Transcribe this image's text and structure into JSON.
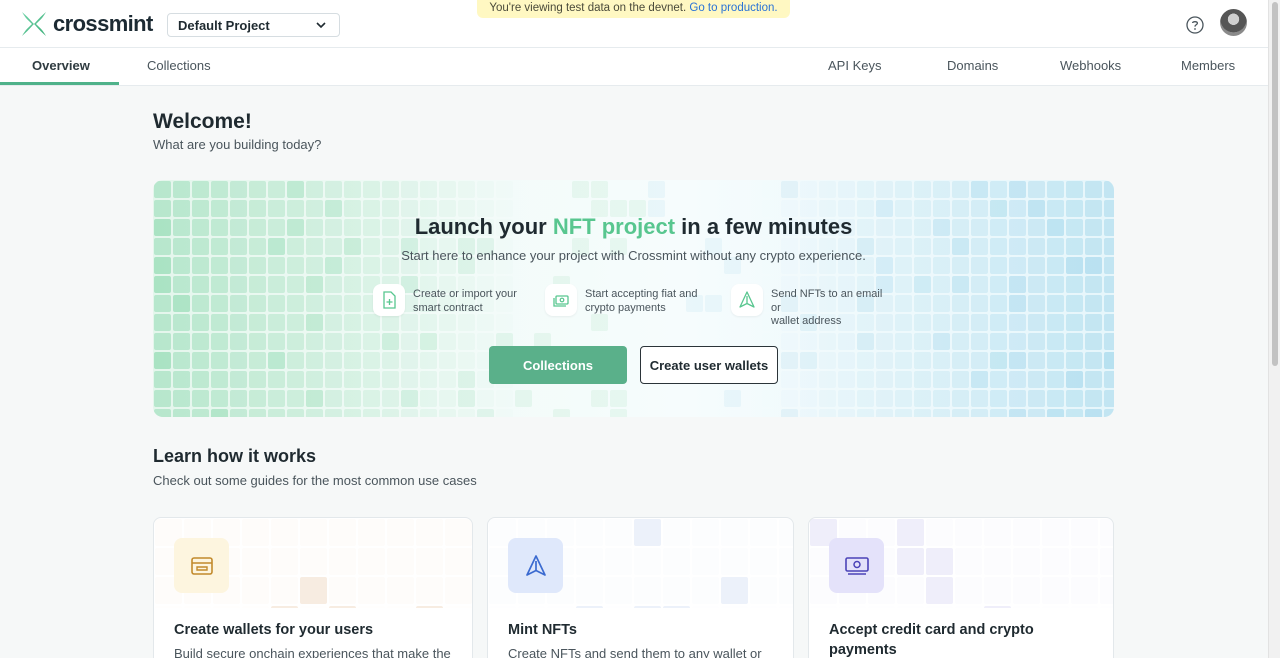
{
  "brand": {
    "name": "crossmint",
    "accent": "#58c68f",
    "primary_button": "#5ab08a"
  },
  "project_select": {
    "value": "Default Project"
  },
  "banner": {
    "text": "You're viewing test data on the devnet.",
    "link": "Go to production."
  },
  "header": {
    "help_icon": "question-circle-icon",
    "avatar": "user-avatar"
  },
  "tabs": {
    "left": [
      {
        "label": "Overview",
        "active": true
      },
      {
        "label": "Collections",
        "active": false
      }
    ],
    "right": [
      {
        "label": "API Keys"
      },
      {
        "label": "Domains"
      },
      {
        "label": "Webhooks"
      },
      {
        "label": "Members"
      }
    ]
  },
  "welcome": {
    "title": "Welcome!",
    "subtitle": "What are you building today?"
  },
  "hero": {
    "title_pre": "Launch your ",
    "title_accent": "NFT project",
    "title_post": " in a few minutes",
    "subtitle": "Start here to enhance your project with Crossmint without any crypto experience.",
    "features": [
      {
        "icon": "file-plus-icon",
        "line1": "Create or import your",
        "line2": "smart contract"
      },
      {
        "icon": "cash-icon",
        "line1": "Start accepting fiat and",
        "line2": "crypto payments"
      },
      {
        "icon": "send-icon",
        "line1": "Send NFTs to an email or",
        "line2": "wallet address"
      }
    ],
    "primary_button": "Collections",
    "secondary_button": "Create user wallets"
  },
  "learn": {
    "title": "Learn how it works",
    "subtitle": "Check out some guides for the most common use cases",
    "cards": [
      {
        "icon": "wallet-icon",
        "title": "Create wallets for your users",
        "title2": "",
        "desc": "Build secure onchain experiences that make the"
      },
      {
        "icon": "mint-send-icon",
        "title": "Mint NFTs",
        "title2": "",
        "desc": "Create NFTs and send them to any wallet or"
      },
      {
        "icon": "payments-icon",
        "title": "Accept credit card and crypto",
        "title2": "payments",
        "desc": ""
      }
    ]
  }
}
